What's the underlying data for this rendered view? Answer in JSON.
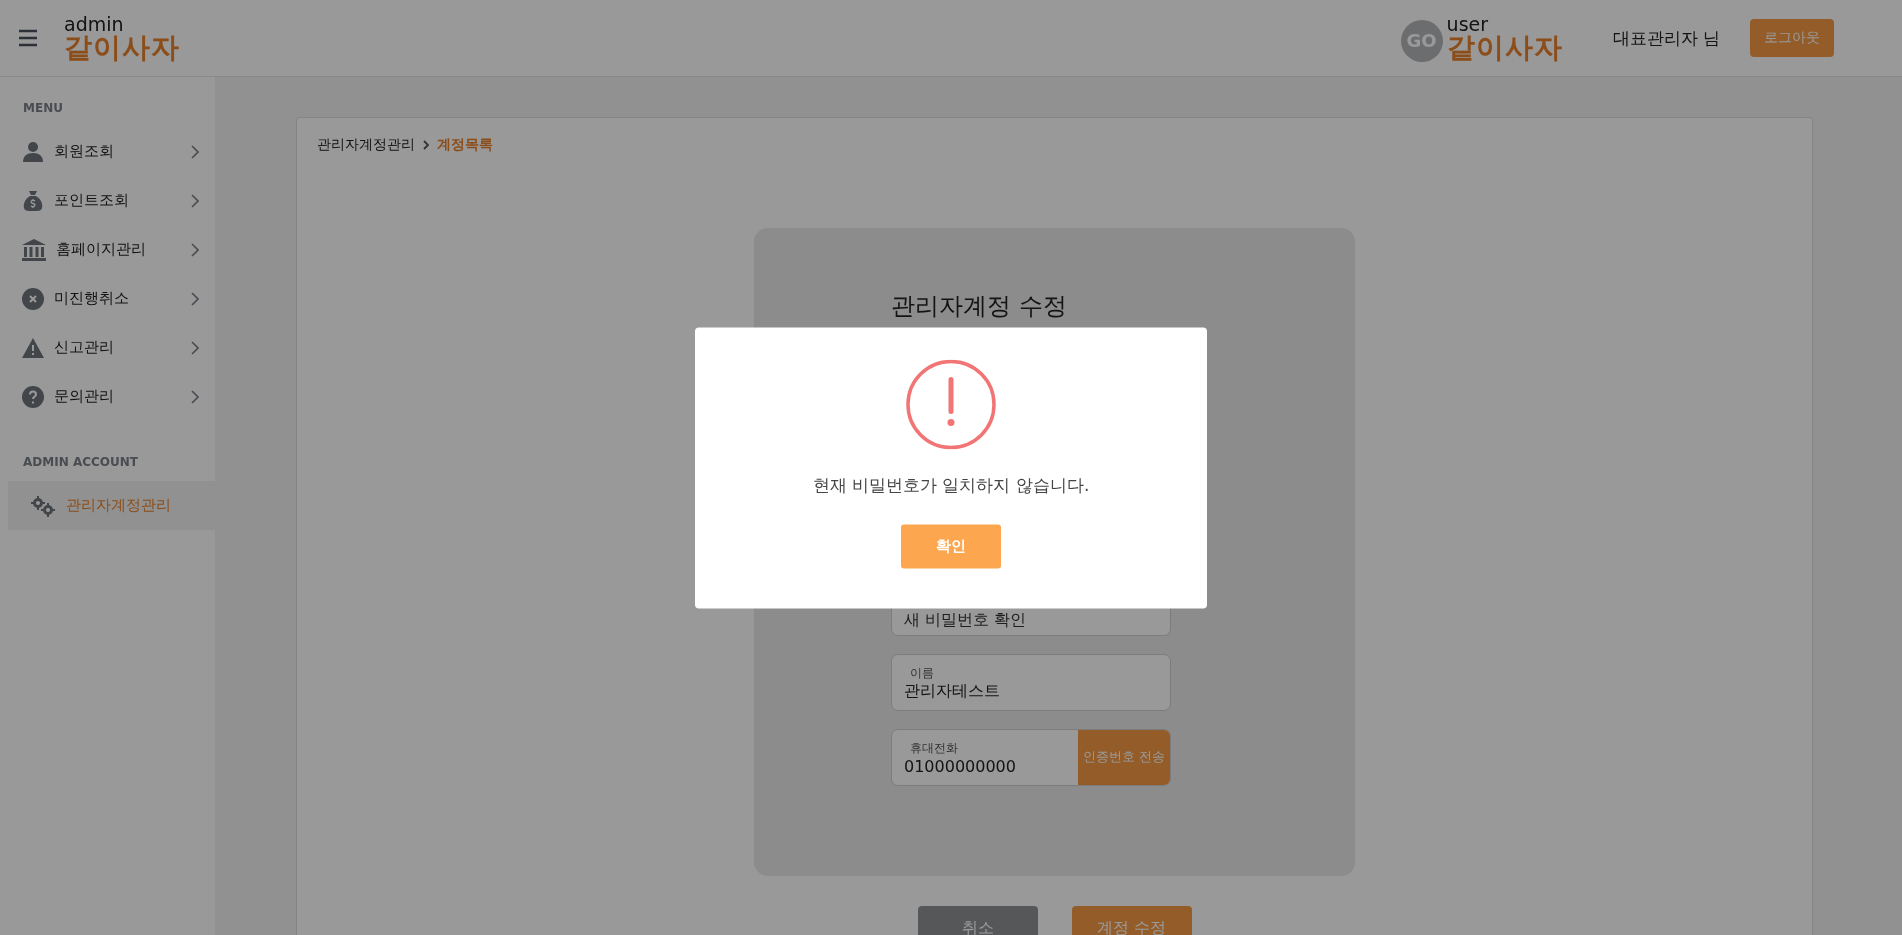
{
  "header": {
    "logo": {
      "small": "admin",
      "main": "같이사자"
    },
    "user_logo": {
      "badge": "GO",
      "small": "user",
      "main": "같이사자"
    },
    "user_name": "대표관리자 님",
    "logout": "로그아웃"
  },
  "sidebar": {
    "sections": [
      {
        "title": "MENU",
        "items": [
          {
            "label": "회원조회",
            "kind": "submenu",
            "selected": false
          },
          {
            "label": "포인트조회",
            "kind": "submenu",
            "selected": false
          },
          {
            "label": "홈페이지관리",
            "kind": "submenu",
            "selected": false
          },
          {
            "label": "미진행취소",
            "kind": "submenu",
            "selected": false
          },
          {
            "label": "신고관리",
            "kind": "submenu",
            "selected": false
          },
          {
            "label": "문의관리",
            "kind": "submenu",
            "selected": false
          }
        ]
      },
      {
        "title": "ADMIN ACCOUNT",
        "items": [
          {
            "label": "관리자계정관리",
            "kind": "link",
            "selected": true
          }
        ]
      }
    ]
  },
  "breadcrumb": [
    "관리자계정관리",
    "계정목록"
  ],
  "form": {
    "title": "관리자계정 수정",
    "fields": [
      {
        "kind": "placeholder",
        "placeholder": "새 비밀번호 확인"
      },
      {
        "kind": "labeled",
        "label": "이름",
        "value": "관리자테스트"
      },
      {
        "kind": "labeled_action",
        "label": "휴대전화",
        "value": "01000000000",
        "action": "인증번호 전송"
      }
    ]
  },
  "buttons": [
    {
      "label": "취소",
      "kind": "secondary"
    },
    {
      "label": "계정 수정",
      "kind": "primary"
    }
  ],
  "modal": {
    "message": "현재 비밀번호가 일치하지 않습니다.",
    "confirm": "확인"
  }
}
